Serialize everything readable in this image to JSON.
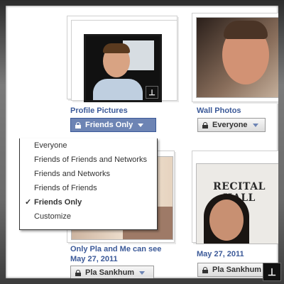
{
  "albums": [
    {
      "title": "Profile Pictures",
      "privacy_label": "Friends Only"
    },
    {
      "title": "Wall Photos",
      "privacy_label": "Everyone"
    },
    {
      "title_line1": "Only Pla and Me can see",
      "title_line2": "May 27, 2011",
      "privacy_label": "Pla Sankhum"
    },
    {
      "title": "May 27, 2011",
      "privacy_label": "Pla Sankhum"
    }
  ],
  "photo4_sign_text": "RECITAL HALL",
  "privacy_menu": {
    "items": [
      {
        "label": "Everyone"
      },
      {
        "label": "Friends of Friends and Networks"
      },
      {
        "label": "Friends and Networks"
      },
      {
        "label": "Friends of Friends"
      },
      {
        "label": "Friends Only",
        "checkmark": "✓"
      },
      {
        "label": "Customize"
      }
    ],
    "selected_index": 4
  },
  "colors": {
    "link_blue": "#3b5998",
    "active_button": "#6d84b4"
  },
  "icons": [
    "lock-icon",
    "chevron-down-icon",
    "checkmark-icon",
    "watermark-logo-icon"
  ]
}
